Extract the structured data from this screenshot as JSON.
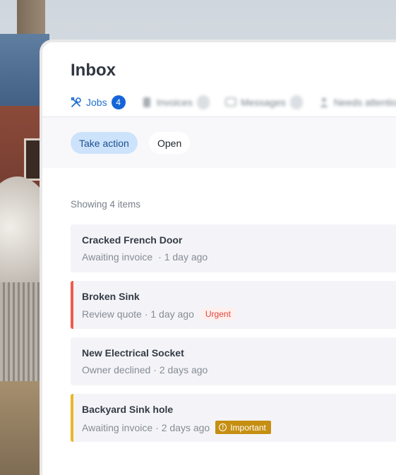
{
  "inbox": {
    "title": "Inbox",
    "tabs": [
      {
        "label": "Jobs",
        "count": "4",
        "icon": "tools-icon",
        "active": true
      },
      {
        "label": "Invoices",
        "count": "",
        "icon": "invoice-icon",
        "active": false
      },
      {
        "label": "Messages",
        "count": "",
        "icon": "message-icon",
        "active": false
      },
      {
        "label": "Needs attention",
        "count": "",
        "icon": "person-icon",
        "active": false
      }
    ]
  },
  "filters": {
    "take_action": "Take action",
    "open": "Open"
  },
  "list": {
    "showing": "Showing 4 items",
    "items": [
      {
        "name": "Cracked French Door",
        "status": "Awaiting invoice",
        "time": "· 1 day ago",
        "flag": ""
      },
      {
        "name": "Broken Sink",
        "status": "Review quote",
        "time": "· 1 day ago",
        "flag": "Urgent"
      },
      {
        "name": "New Electrical Socket",
        "status": "Owner declined",
        "time": "· 2 days ago",
        "flag": ""
      },
      {
        "name": "Backyard Sink hole",
        "status": "Awaiting invoice",
        "time": "· 2 days ago",
        "flag": "Important"
      }
    ]
  },
  "colors": {
    "accent": "#1565d8",
    "urgent": "#ef5a4e",
    "important": "#eab62a"
  }
}
